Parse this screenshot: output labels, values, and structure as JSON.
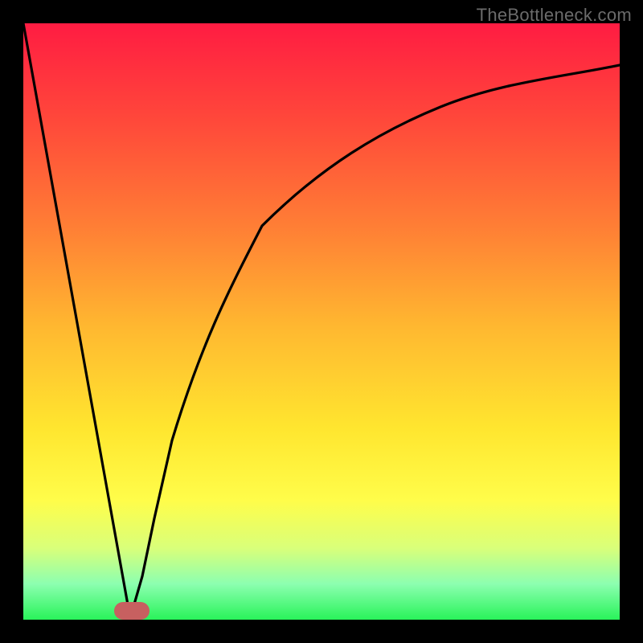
{
  "watermark": "TheBottleneck.com",
  "chart_data": {
    "type": "line",
    "title": "",
    "xlabel": "",
    "ylabel": "",
    "xlim": [
      0,
      100
    ],
    "ylim": [
      0,
      100
    ],
    "grid": false,
    "legend": false,
    "series": [
      {
        "name": "left-slope",
        "x": [
          0,
          18
        ],
        "values": [
          100,
          0
        ]
      },
      {
        "name": "right-curve",
        "x": [
          18,
          20,
          22,
          25,
          30,
          35,
          40,
          50,
          60,
          70,
          80,
          90,
          100
        ],
        "values": [
          0,
          7,
          17,
          30,
          47,
          58,
          66,
          76,
          82,
          86,
          89,
          91,
          93
        ]
      }
    ],
    "marker": {
      "x": 18,
      "y": 0,
      "color": "#c76060"
    },
    "gradient_stops": [
      {
        "pos": 0,
        "color": "#ff1c42"
      },
      {
        "pos": 17,
        "color": "#ff4a3a"
      },
      {
        "pos": 34,
        "color": "#ff7e35"
      },
      {
        "pos": 51,
        "color": "#ffb830"
      },
      {
        "pos": 68,
        "color": "#ffe62f"
      },
      {
        "pos": 80,
        "color": "#fffd4a"
      },
      {
        "pos": 88,
        "color": "#d9ff7a"
      },
      {
        "pos": 94,
        "color": "#8cffb0"
      },
      {
        "pos": 100,
        "color": "#29f35a"
      }
    ]
  }
}
